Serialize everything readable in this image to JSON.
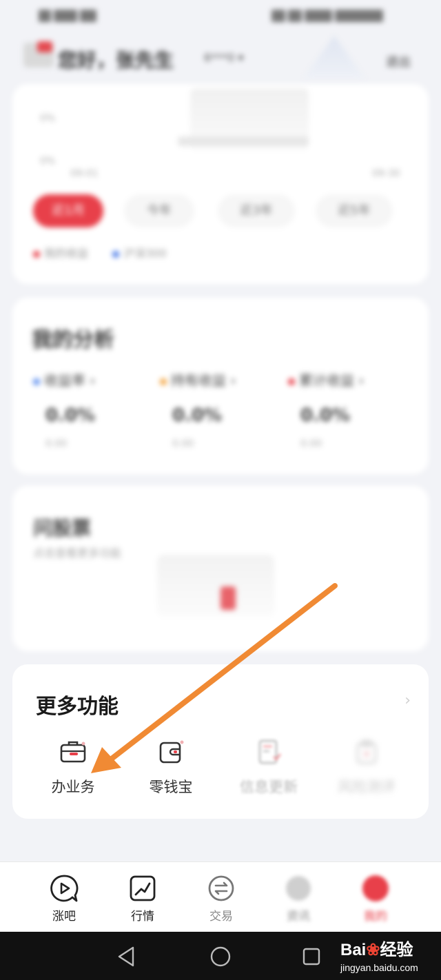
{
  "header": {
    "greeting": "您好，张先生",
    "account_masked": "6***0 ▾",
    "exit_label": "退出"
  },
  "profit_card": {
    "y_tick_top": "0%",
    "y_tick_bottom": "0%",
    "x_start": "09-01",
    "x_end": "09-30",
    "ranges": [
      "近1月",
      "今年",
      "近3年",
      "近5年"
    ],
    "legend": [
      "我的收益",
      "沪深300"
    ]
  },
  "analysis_card": {
    "title": "我的分析",
    "metrics": [
      {
        "label": "收益率",
        "value": "0.0%",
        "sub": "0.00"
      },
      {
        "label": "持有收益",
        "value": "0.0%",
        "sub": "0.00"
      },
      {
        "label": "累计收益",
        "value": "0.0%",
        "sub": "0.00"
      }
    ]
  },
  "empty_card": {
    "title": "问股票",
    "subtitle": "点击查看更多功能"
  },
  "more_features": {
    "title": "更多功能",
    "items": [
      {
        "label": "办业务",
        "icon": "briefcase-icon"
      },
      {
        "label": "零钱宝",
        "icon": "wallet-icon"
      },
      {
        "label": "信息更新",
        "icon": "document-icon"
      },
      {
        "label": "风险测评",
        "icon": "clipboard-icon"
      }
    ]
  },
  "bottom_nav": {
    "items": [
      {
        "label": "涨吧",
        "icon": "play-chat-icon"
      },
      {
        "label": "行情",
        "icon": "trend-icon"
      },
      {
        "label": "交易",
        "icon": "exchange-icon"
      },
      {
        "label": "资讯",
        "icon": "news-icon"
      },
      {
        "label": "我的",
        "icon": "profile-icon"
      }
    ]
  },
  "watermark": {
    "brand_prefix": "Bai",
    "brand_suffix": "经验",
    "url": "jingyan.baidu.com"
  },
  "colors": {
    "accent_red": "#e8404a",
    "arrow_orange": "#f08a34",
    "background": "#f2f3f7"
  }
}
